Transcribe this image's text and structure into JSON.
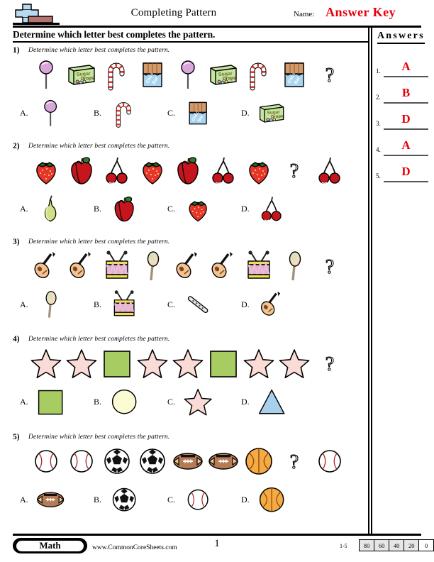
{
  "header": {
    "title": "Completing Pattern",
    "name_label": "Name:",
    "name_value": "Answer Key",
    "logo_name": "commoncoresheets-plus-logo",
    "accent_red": "#e8000a"
  },
  "directions": "Determine which letter best completes the pattern.",
  "answers_panel": {
    "title": "Answers",
    "rows": [
      {
        "num": "1.",
        "value": "A"
      },
      {
        "num": "2.",
        "value": "B"
      },
      {
        "num": "3.",
        "value": "D"
      },
      {
        "num": "4.",
        "value": "A"
      },
      {
        "num": "5.",
        "value": "D"
      }
    ]
  },
  "questions": [
    {
      "num": "1)",
      "text": "Determine which letter best completes the pattern.",
      "pattern": [
        "lollipop",
        "sugar-drops-box",
        "candy-cane",
        "chocolate-bar",
        "lollipop",
        "sugar-drops-box",
        "candy-cane",
        "chocolate-bar",
        "question-mark"
      ],
      "choices": [
        {
          "letter": "A.",
          "icon": "lollipop"
        },
        {
          "letter": "B.",
          "icon": "candy-cane"
        },
        {
          "letter": "C.",
          "icon": "chocolate-bar"
        },
        {
          "letter": "D.",
          "icon": "sugar-drops-box"
        }
      ],
      "correct": "A"
    },
    {
      "num": "2)",
      "text": "Determine which letter best completes the pattern.",
      "pattern": [
        "strawberry",
        "apple",
        "cherries",
        "strawberry",
        "apple",
        "cherries",
        "strawberry",
        "question-mark",
        "cherries"
      ],
      "choices": [
        {
          "letter": "A.",
          "icon": "pear"
        },
        {
          "letter": "B.",
          "icon": "apple"
        },
        {
          "letter": "C.",
          "icon": "strawberry"
        },
        {
          "letter": "D.",
          "icon": "cherries"
        }
      ],
      "correct": "B"
    },
    {
      "num": "3)",
      "text": "Determine which letter best completes the pattern.",
      "pattern": [
        "guitar",
        "guitar",
        "drum",
        "maraca",
        "guitar",
        "guitar",
        "drum",
        "maraca",
        "question-mark"
      ],
      "choices": [
        {
          "letter": "A.",
          "icon": "maraca"
        },
        {
          "letter": "B.",
          "icon": "drum"
        },
        {
          "letter": "C.",
          "icon": "flute"
        },
        {
          "letter": "D.",
          "icon": "guitar"
        }
      ],
      "correct": "D"
    },
    {
      "num": "4)",
      "text": "Determine which letter best completes the pattern.",
      "pattern": [
        "star",
        "star",
        "square",
        "star",
        "star",
        "square",
        "star",
        "star",
        "question-mark"
      ],
      "choices": [
        {
          "letter": "A.",
          "icon": "square"
        },
        {
          "letter": "B.",
          "icon": "circle"
        },
        {
          "letter": "C.",
          "icon": "star"
        },
        {
          "letter": "D.",
          "icon": "triangle"
        }
      ],
      "correct": "A"
    },
    {
      "num": "5)",
      "text": "Determine which letter best completes the pattern.",
      "pattern": [
        "baseball",
        "baseball",
        "soccerball",
        "soccerball",
        "football",
        "football",
        "basketball",
        "question-mark",
        "baseball"
      ],
      "choices": [
        {
          "letter": "A.",
          "icon": "football"
        },
        {
          "letter": "B.",
          "icon": "soccerball"
        },
        {
          "letter": "C.",
          "icon": "baseball"
        },
        {
          "letter": "D.",
          "icon": "basketball"
        }
      ],
      "correct": "D"
    }
  ],
  "footer": {
    "subject_badge": "Math",
    "site": "www.CommonCoreSheets.com",
    "page_number": "1",
    "score_range_label": "1-5",
    "score_values": [
      "80",
      "60",
      "40",
      "20",
      "0"
    ]
  },
  "palette": {
    "star_fill": "#fbdbd5",
    "square_fill": "#a6cc62",
    "circle_fill": "#fcfcd4",
    "triangle_fill": "#a8cfec",
    "lollipop_fill": "#d9a6d9",
    "candy_box_fill": "#c5e6a0",
    "choc_wrapper_fill": "#a9d4f0",
    "choc_bar_fill": "#d49a6a",
    "strawberry_fill": "#e8352b",
    "apple_fill": "#c4161c",
    "cherry_fill": "#c4161c",
    "pear_fill": "#d3df86",
    "guitar_fill": "#f5c393",
    "drum_fill": "#c9b8e0",
    "drum_rim": "#f2e04a",
    "maraca_fill": "#f0ddc0",
    "football_fill": "#b57b56",
    "basketball_fill": "#f5ab42",
    "baseball_fill": "#ffffff"
  }
}
